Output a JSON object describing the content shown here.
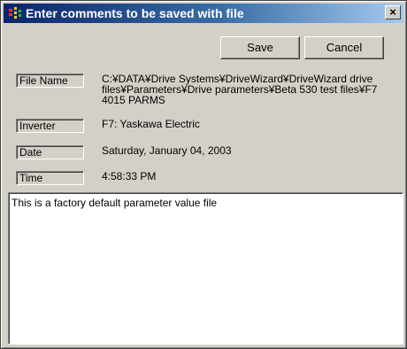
{
  "window": {
    "title": "Enter comments to be saved with file"
  },
  "buttons": {
    "save_label": "Save",
    "cancel_label": "Cancel",
    "close_label": "×"
  },
  "fields": [
    {
      "label": "File Name",
      "value": "C:¥DATA¥Drive Systems¥DriveWizard¥DriveWizard drive files¥Parameters¥Drive parameters¥Beta 530 test files¥F7 4015 PARMS"
    },
    {
      "label": "Inverter",
      "value": "F7: Yaskawa Electric"
    },
    {
      "label": "Date",
      "value": "Saturday, January 04, 2003"
    },
    {
      "label": "Time",
      "value": "4:58:33 PM"
    }
  ],
  "comment": {
    "text": "This is a factory default parameter value file"
  }
}
